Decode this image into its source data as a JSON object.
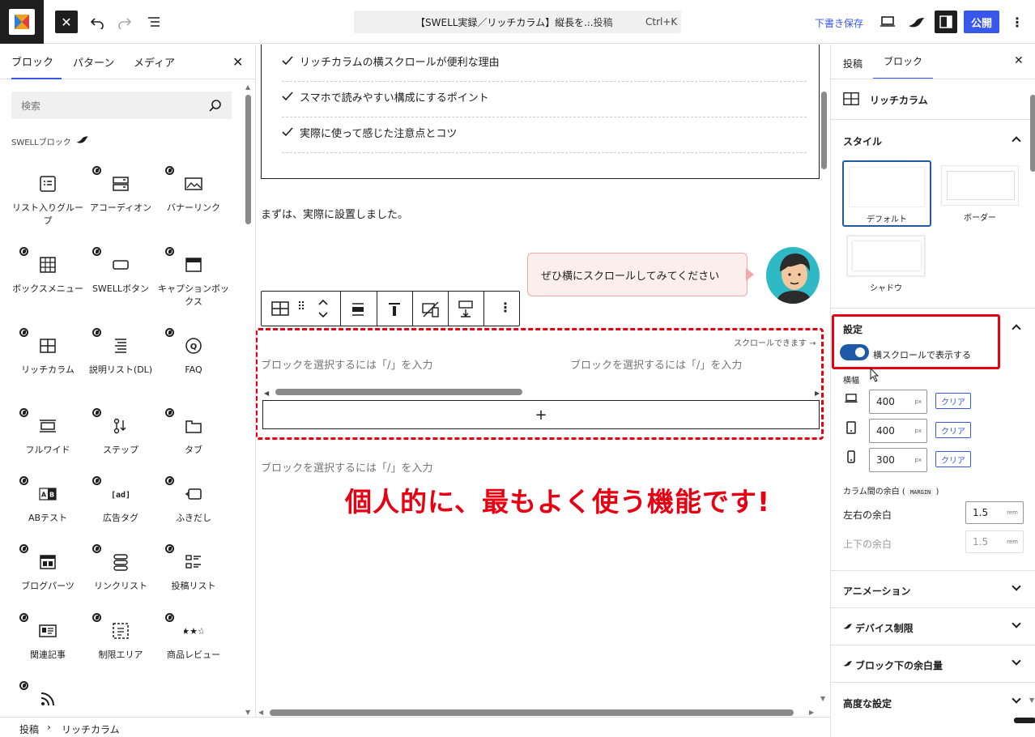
{
  "topbar": {
    "doc_title": "【SWELL実録／リッチカラム】縦長を...",
    "doc_type": "· 投稿",
    "shortcut": "Ctrl+K",
    "save_draft": "下書き保存",
    "publish": "公開"
  },
  "inserter": {
    "tabs": [
      "ブロック",
      "パターン",
      "メディア"
    ],
    "search_placeholder": "検索",
    "category": "SWELLブロック",
    "blocks": [
      {
        "label": "リスト入りグループ",
        "icon": "list-group-icon"
      },
      {
        "label": "アコーディオン",
        "icon": "accordion-icon"
      },
      {
        "label": "バナーリンク",
        "icon": "banner-link-icon"
      },
      {
        "label": "ボックスメニュー",
        "icon": "box-menu-icon"
      },
      {
        "label": "SWELLボタン",
        "icon": "button-icon"
      },
      {
        "label": "キャプションボックス",
        "icon": "caption-box-icon"
      },
      {
        "label": "リッチカラム",
        "icon": "rich-column-icon"
      },
      {
        "label": "説明リスト(DL)",
        "icon": "description-list-icon"
      },
      {
        "label": "FAQ",
        "icon": "faq-icon"
      },
      {
        "label": "フルワイド",
        "icon": "full-wide-icon"
      },
      {
        "label": "ステップ",
        "icon": "step-icon"
      },
      {
        "label": "タブ",
        "icon": "tab-icon"
      },
      {
        "label": "ABテスト",
        "icon": "ab-test-icon"
      },
      {
        "label": "広告タグ",
        "icon": "ad-tag-icon"
      },
      {
        "label": "ふきだし",
        "icon": "speech-bubble-icon"
      },
      {
        "label": "ブログパーツ",
        "icon": "blog-parts-icon"
      },
      {
        "label": "リンクリスト",
        "icon": "link-list-icon"
      },
      {
        "label": "投稿リスト",
        "icon": "post-list-icon"
      },
      {
        "label": "関連記事",
        "icon": "related-post-icon"
      },
      {
        "label": "制限エリア",
        "icon": "restricted-area-icon"
      },
      {
        "label": "商品レビュー",
        "icon": "product-review-icon"
      },
      {
        "label": "",
        "icon": "rss-icon"
      }
    ]
  },
  "editor": {
    "checklist": [
      "リッチカラムの横スクロールが便利な理由",
      "スマホで読みやすい構成にするポイント",
      "実際に使って感じた注意点とコツ"
    ],
    "paragraph": "まずは、実際に設置しました。",
    "bubble_text": "ぜひ横にスクロールしてみてください",
    "scroll_hint": "スクロールできます →",
    "block_placeholder": "ブロックを選択するには「/」を入力",
    "add_block": "+",
    "annotation": "個人的に、最もよく使う機能です!"
  },
  "settings": {
    "tabs": [
      "投稿",
      "ブロック"
    ],
    "block_name": "リッチカラム",
    "style_heading": "スタイル",
    "styles": [
      "デフォルト",
      "ボーダー",
      "シャドウ"
    ],
    "setting_heading": "設定",
    "toggle_label": "横スクロールで表示する",
    "toggle_on": true,
    "width_label": "横幅",
    "widths": [
      {
        "device": "desktop",
        "value": "400",
        "unit": "px",
        "clear": "クリア"
      },
      {
        "device": "tablet",
        "value": "400",
        "unit": "px",
        "clear": "クリア"
      },
      {
        "device": "mobile",
        "value": "300",
        "unit": "px",
        "clear": "クリア"
      }
    ],
    "margin_label": "カラム間の余白 (",
    "margin_tag": "MARGIN",
    "margin_close": ")",
    "lr_label": "左右の余白",
    "lr_value": "1.5",
    "tb_label": "上下の余白",
    "tb_value": "1.5",
    "margin_unit": "rem",
    "panels": [
      "アニメーション",
      "デバイス制限",
      "ブロック下の余白量",
      "高度な設定"
    ]
  },
  "status": {
    "crumbs": [
      "投稿",
      "リッチカラム"
    ]
  },
  "colors": {
    "accent": "#3858e9",
    "annotation_red": "#e60012",
    "toggle": "#1e5aa8"
  }
}
